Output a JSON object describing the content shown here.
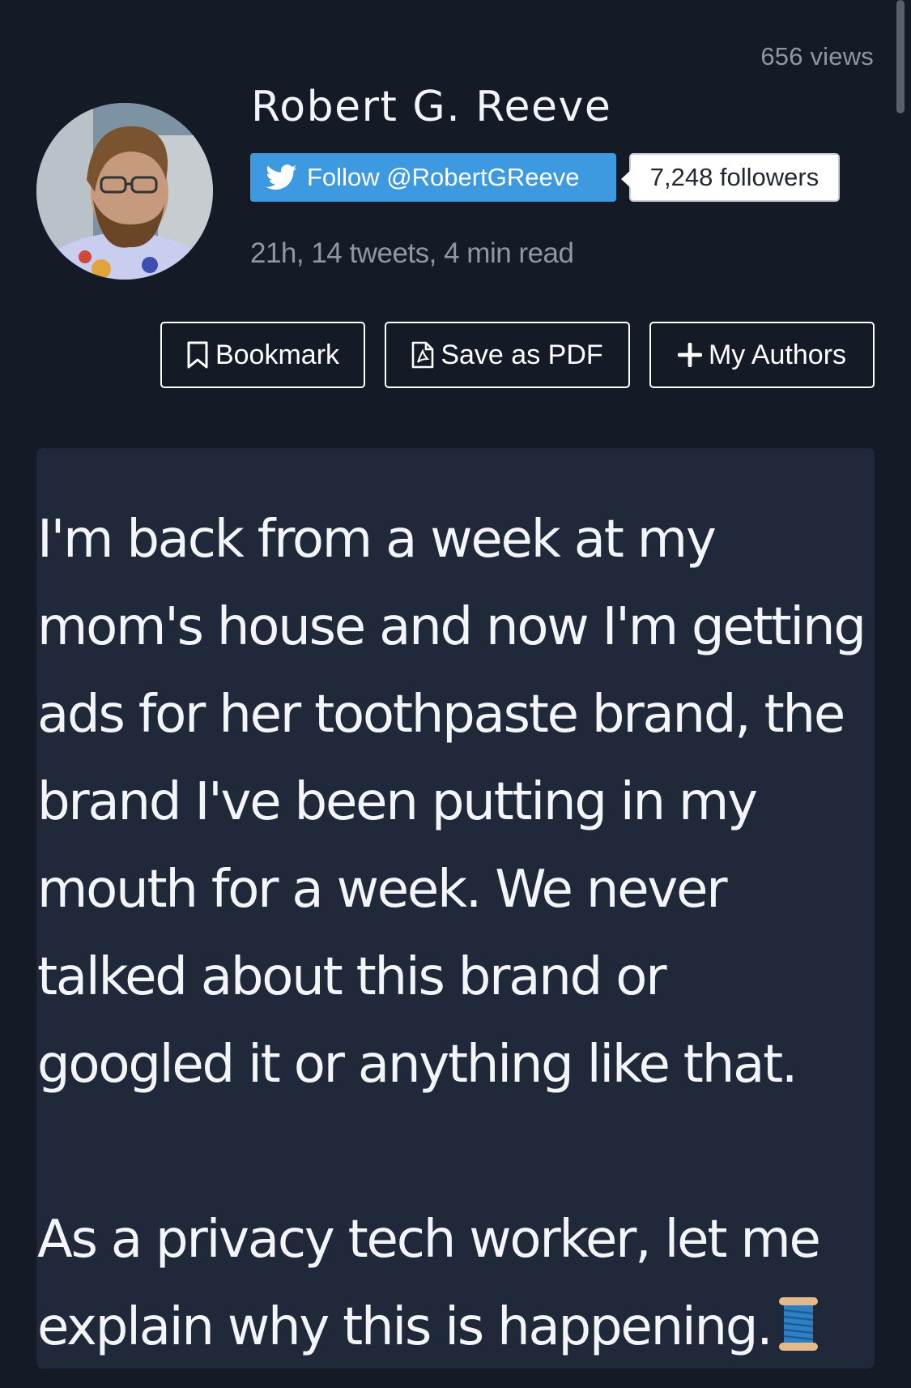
{
  "header": {
    "views": "656 views",
    "author_name": "Robert G. Reeve",
    "follow_label": "Follow @RobertGReeve",
    "followers": "7,248 followers",
    "meta": "21h, 14 tweets, 4 min read"
  },
  "actions": {
    "bookmark": "Bookmark",
    "save_pdf": "Save as PDF",
    "my_authors": "My Authors"
  },
  "tweet": {
    "paragraph_1": "I'm back from a week at my mom's house and now I'm getting ads for her toothpaste brand, the brand I've been putting in my mouth for a week. We never talked about this brand or googled it or anything like that.",
    "paragraph_2": "As a privacy tech worker, let me explain why this is happening.",
    "emoji": "spool-of-thread-icon"
  },
  "colors": {
    "background": "#151b26",
    "card": "#1f293a",
    "twitter_blue": "#3d9ae0",
    "muted_text": "#8f97a3"
  }
}
